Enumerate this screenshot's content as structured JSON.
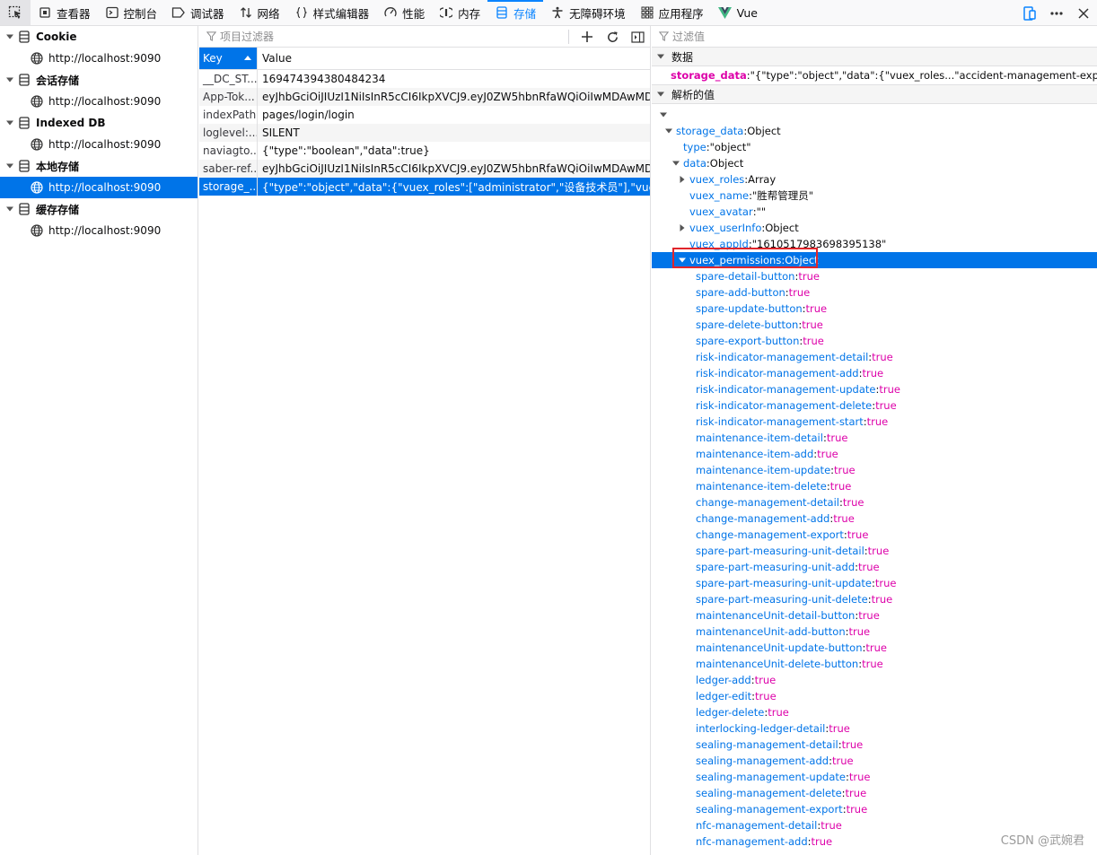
{
  "toolbar": {
    "tabs": [
      {
        "label": "查看器",
        "icon": "inspector-icon"
      },
      {
        "label": "控制台",
        "icon": "console-icon"
      },
      {
        "label": "调试器",
        "icon": "debugger-icon"
      },
      {
        "label": "网络",
        "icon": "network-icon"
      },
      {
        "label": "样式编辑器",
        "icon": "style-editor-icon"
      },
      {
        "label": "性能",
        "icon": "performance-icon"
      },
      {
        "label": "内存",
        "icon": "memory-icon"
      },
      {
        "label": "存储",
        "icon": "storage-icon"
      },
      {
        "label": "无障碍环境",
        "icon": "accessibility-icon"
      },
      {
        "label": "应用程序",
        "icon": "application-icon"
      },
      {
        "label": "Vue",
        "icon": "vue-icon"
      }
    ],
    "active_tab": "存储",
    "accent": "#0a84ff"
  },
  "sidebar": {
    "categories": [
      {
        "label": "Cookie",
        "host": "http://localhost:9090"
      },
      {
        "label": "会话存储",
        "host": "http://localhost:9090"
      },
      {
        "label": "Indexed DB",
        "host": "http://localhost:9090"
      },
      {
        "label": "本地存储",
        "host": "http://localhost:9090"
      },
      {
        "label": "缓存存储",
        "host": "http://localhost:9090"
      }
    ],
    "selected_category": "本地存储"
  },
  "table": {
    "filter_placeholder": "项目过滤器",
    "col_key": "Key",
    "col_value": "Value",
    "rows": [
      {
        "key": "__DC_ST...",
        "value": "169474394380484234"
      },
      {
        "key": "App-Tok...",
        "value": "eyJhbGciOiJIUzI1NiIsInR5cCI6IkpXVCJ9.eyJ0ZW5hbnRfaWQiOiIwMDAwMDAiLC..."
      },
      {
        "key": "indexPath",
        "value": "pages/login/login"
      },
      {
        "key": "loglevel:...",
        "value": "SILENT"
      },
      {
        "key": "naviagto...",
        "value": "{\"type\":\"boolean\",\"data\":true}"
      },
      {
        "key": "saber-ref...",
        "value": "eyJhbGciOiJIUzI1NiIsInR5cCI6IkpXVCJ9.eyJ0ZW5hbnRfaWQiOiIwMDAwMDAiLC..."
      },
      {
        "key": "storage_...",
        "value": "{\"type\":\"object\",\"data\":{\"vuex_roles\":[\"administrator\",\"设备技术员\"],\"vuex_name\":..."
      }
    ],
    "selected_row": 6
  },
  "details": {
    "filter_placeholder": "过滤值",
    "data_section": "数据",
    "data_key": "storage_data",
    "data_value": ":\"{\"type\":\"object\",\"data\":{\"vuex_roles...\"accident-management-export\":true}}\"",
    "parsed_section": "解析的值",
    "tree": {
      "root": {
        "key": "storage_data",
        "type": "Object"
      },
      "type_field": {
        "key": "type",
        "value": "\"object\""
      },
      "data_node": {
        "key": "data",
        "type": "Object"
      },
      "data_children": [
        {
          "key": "vuex_roles",
          "value": "Array",
          "expandable": true
        },
        {
          "key": "vuex_name",
          "value": "\"胜帮管理员\"",
          "expandable": false
        },
        {
          "key": "vuex_avatar",
          "value": "\"\"",
          "expandable": false
        },
        {
          "key": "vuex_userInfo",
          "value": "Object",
          "expandable": true
        },
        {
          "key": "vuex_appId",
          "value": "\"1610517983698395138\"",
          "expandable": false
        }
      ],
      "permissions_node": {
        "key": "vuex_permissions",
        "type": "Object"
      },
      "permissions": [
        "spare-detail-button",
        "spare-add-button",
        "spare-update-button",
        "spare-delete-button",
        "spare-export-button",
        "risk-indicator-management-detail",
        "risk-indicator-management-add",
        "risk-indicator-management-update",
        "risk-indicator-management-delete",
        "risk-indicator-management-start",
        "maintenance-item-detail",
        "maintenance-item-add",
        "maintenance-item-update",
        "maintenance-item-delete",
        "change-management-detail",
        "change-management-add",
        "change-management-export",
        "spare-part-measuring-unit-detail",
        "spare-part-measuring-unit-add",
        "spare-part-measuring-unit-update",
        "spare-part-measuring-unit-delete",
        "maintenanceUnit-detail-button",
        "maintenanceUnit-add-button",
        "maintenanceUnit-update-button",
        "maintenanceUnit-delete-button",
        "ledger-add",
        "ledger-edit",
        "ledger-delete",
        "interlocking-ledger-detail",
        "sealing-management-detail",
        "sealing-management-add",
        "sealing-management-update",
        "sealing-management-delete",
        "sealing-management-export",
        "nfc-management-detail",
        "nfc-management-add"
      ],
      "perm_value": "true"
    }
  },
  "watermark": "CSDN @武婉君"
}
